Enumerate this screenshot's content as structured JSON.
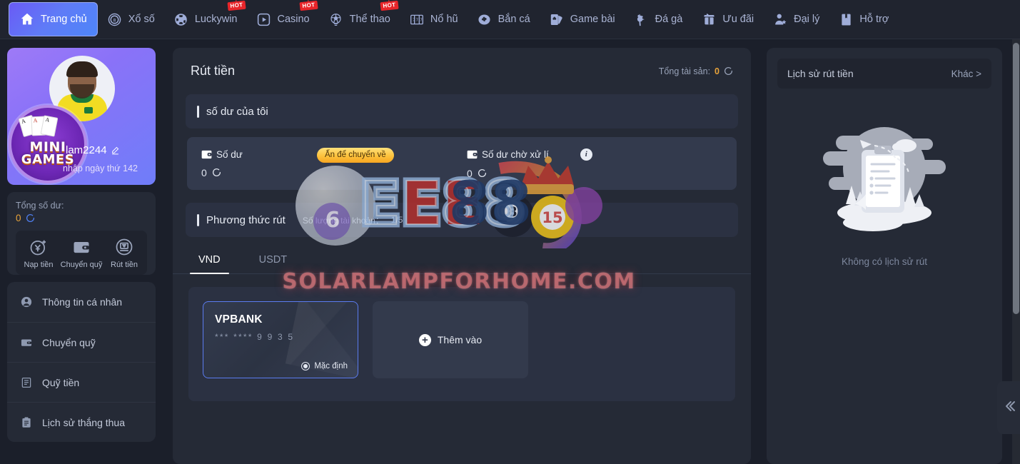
{
  "colors": {
    "page_bg": "#1b1f2a",
    "panel_bg": "#252a36",
    "nav_bg": "#20242f",
    "accent_purple": "#6a5bf5",
    "accent_blue": "#5b7cf0",
    "amount_orange": "#e8a33a",
    "hot_red": "#e8252a",
    "pill_yellow": "#fdc23d"
  },
  "nav": {
    "items": [
      {
        "label": "Trang chủ",
        "icon": "home-icon",
        "active": true,
        "hot": false
      },
      {
        "label": "Xổ số",
        "icon": "lottery-ball-icon",
        "active": false,
        "hot": false
      },
      {
        "label": "Luckywin",
        "icon": "poker-chip-icon",
        "active": false,
        "hot": true
      },
      {
        "label": "Casino",
        "icon": "play-circle-icon",
        "active": false,
        "hot": true
      },
      {
        "label": "Thể thao",
        "icon": "soccer-ball-icon",
        "active": false,
        "hot": true
      },
      {
        "label": "Nổ hũ",
        "icon": "slot-machine-icon",
        "active": false,
        "hot": false
      },
      {
        "label": "Bắn cá",
        "icon": "fish-icon",
        "active": false,
        "hot": false
      },
      {
        "label": "Game bài",
        "icon": "playing-cards-icon",
        "active": false,
        "hot": false
      },
      {
        "label": "Đá gà",
        "icon": "rooster-icon",
        "active": false,
        "hot": false
      },
      {
        "label": "Ưu đãi",
        "icon": "gift-icon",
        "active": false,
        "hot": false
      },
      {
        "label": "Đại lý",
        "icon": "agent-user-icon",
        "active": false,
        "hot": false
      },
      {
        "label": "Hỗ trợ",
        "icon": "book-icon",
        "active": false,
        "hot": false
      }
    ],
    "hot_label": "HOT"
  },
  "sidebar": {
    "profile": {
      "username": "lam2244",
      "login_streak": "nhập ngày thứ 142",
      "badge_line1": "MINI",
      "badge_line2": "GAMES",
      "edit_icon": "pencil-icon",
      "avatar_icon": "avatar"
    },
    "balance": {
      "label": "Tổng số dư:",
      "amount": "0",
      "refresh_icon": "refresh-icon"
    },
    "quick_actions": [
      {
        "label": "Nạp tiền",
        "icon": "deposit-coin-icon"
      },
      {
        "label": "Chuyển quỹ",
        "icon": "wallet-icon"
      },
      {
        "label": "Rút tiền",
        "icon": "atm-withdraw-icon"
      }
    ],
    "menu": [
      {
        "label": "Thông tin cá nhân",
        "icon": "user-circle-icon"
      },
      {
        "label": "Chuyển quỹ",
        "icon": "wallet-icon"
      },
      {
        "label": "Quỹ tiền",
        "icon": "fund-note-icon"
      },
      {
        "label": "Lịch sử thắng thua",
        "icon": "clipboard-icon"
      }
    ]
  },
  "main": {
    "title": "Rút tiền",
    "asset_total_label": "Tổng tài sản:",
    "asset_total_value": "0",
    "asset_refresh_icon": "refresh-icon",
    "balance_section": {
      "heading": "số dư của tôi",
      "available": {
        "label": "Số dư",
        "value": "0",
        "icon": "wallet-icon",
        "refresh_icon": "refresh-icon"
      },
      "transfer_pill": "Ấn để chuyển về",
      "pending": {
        "label": "Số dư chờ xử lí",
        "value": "0",
        "icon": "wallet-icon",
        "refresh_icon": "refresh-icon",
        "info_icon": "info-icon",
        "info_glyph": "i"
      }
    },
    "method_section": {
      "heading": "Phương thức rút",
      "account_count_label": "Số lượng tài khoản：",
      "account_count_value": "1/5",
      "tabs": [
        {
          "label": "VND",
          "active": true
        },
        {
          "label": "USDT",
          "active": false
        }
      ],
      "bank_card": {
        "name": "VPBANK",
        "masked_number": "***  ****   9 9 3 5",
        "default_label": "Mặc định",
        "is_default": true
      },
      "add_button": {
        "label": "Thêm vào",
        "icon": "plus-circle-icon"
      }
    }
  },
  "history": {
    "title": "Lịch sử rút tiền",
    "more_label": "Khác >",
    "empty_text": "Không có lịch sử rút",
    "empty_icon": "empty-clipboard-illustration"
  },
  "overlays": {
    "watermark_brand": "EE88",
    "watermark_site": "SOLARLAMPFORHOME.COM"
  },
  "collapse_handle": {
    "icon": "chevron-double-left-icon"
  }
}
